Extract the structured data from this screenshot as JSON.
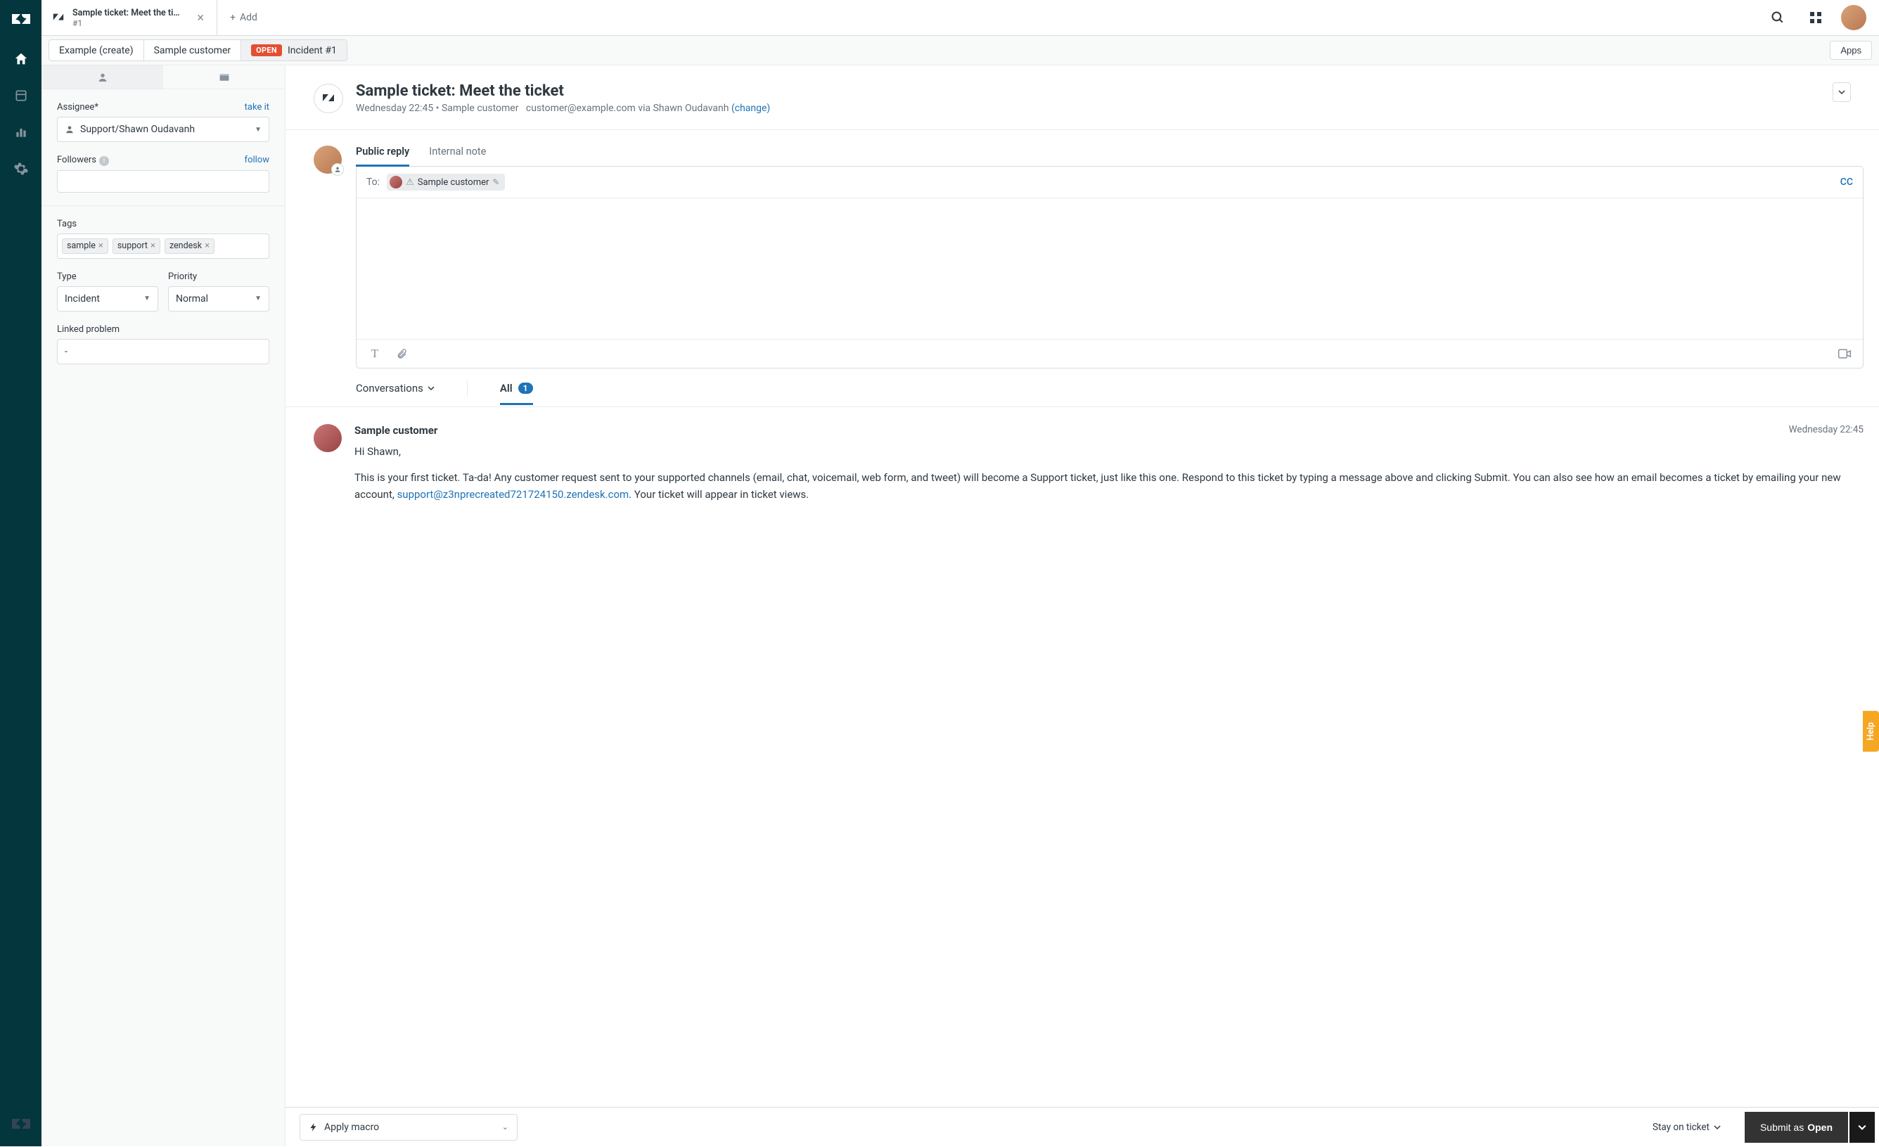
{
  "tab": {
    "title": "Sample ticket: Meet the ti…",
    "sub": "#1",
    "add": "Add"
  },
  "breadcrumb": {
    "example": "Example (create)",
    "customer": "Sample customer",
    "status": "OPEN",
    "incident": "Incident #1",
    "apps": "Apps"
  },
  "sidebar": {
    "assignee_label": "Assignee*",
    "take_it": "take it",
    "assignee_value": "Support/Shawn Oudavanh",
    "followers_label": "Followers",
    "follow": "follow",
    "tags_label": "Tags",
    "tags": [
      "sample",
      "support",
      "zendesk"
    ],
    "type_label": "Type",
    "type_value": "Incident",
    "priority_label": "Priority",
    "priority_value": "Normal",
    "linked_label": "Linked problem",
    "linked_value": "-"
  },
  "ticket": {
    "title": "Sample ticket: Meet the ticket",
    "meta_time": "Wednesday 22:45",
    "meta_customer": "Sample customer",
    "meta_email": "customer@example.com",
    "meta_via": "via Shawn Oudavanh",
    "change": "(change)"
  },
  "composer": {
    "tab_public": "Public reply",
    "tab_internal": "Internal note",
    "to_label": "To:",
    "to_name": "Sample customer",
    "cc": "CC"
  },
  "conversations": {
    "label": "Conversations",
    "all": "All",
    "count": "1"
  },
  "message": {
    "author": "Sample customer",
    "time": "Wednesday 22:45",
    "greeting": "Hi Shawn,",
    "body_pre": "This is your first ticket. Ta-da! Any customer request sent to your supported channels (email, chat, voicemail, web form, and tweet) will become a Support ticket, just like this one. Respond to this ticket by typing a message above and clicking Submit. You can also see how an email becomes a ticket by emailing your new account, ",
    "body_link": "support@z3nprecreated721724150.zendesk.com",
    "body_post": ". Your ticket will appear in ticket views."
  },
  "footer": {
    "macro": "Apply macro",
    "stay": "Stay on ticket",
    "submit_pre": "Submit as ",
    "submit_status": "Open"
  },
  "help": "Help"
}
